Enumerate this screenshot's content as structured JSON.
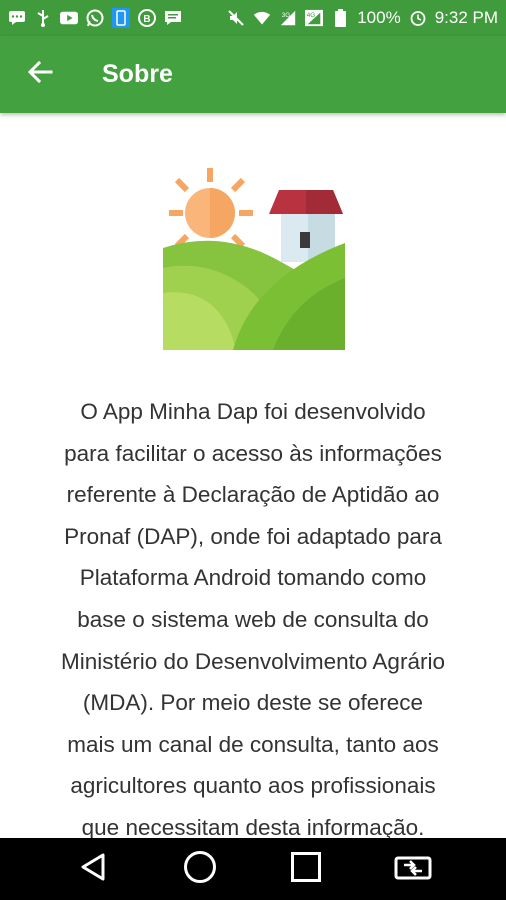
{
  "status_bar": {
    "battery": "100%",
    "time": "9:32 PM",
    "icons_left": [
      "chat-icon",
      "usb-icon",
      "youtube-icon",
      "whatsapp-icon",
      "phone-screen-icon",
      "bitcoin-icon",
      "message-icon"
    ],
    "icons_right": [
      "mute-icon",
      "wifi-icon",
      "signal-3g-icon",
      "signal-4g-icon",
      "battery-icon"
    ]
  },
  "app_bar": {
    "title": "Sobre",
    "back_icon": "arrow-back-icon"
  },
  "content": {
    "illustration": "farm-landscape-icon",
    "about_lines": [
      "O App Minha Dap foi desenvolvido",
      "para facilitar o acesso às informações",
      "referente à Declaração de Aptidão ao",
      "Pronaf (DAP), onde foi adaptado para",
      "Plataforma Android tomando como",
      "base o sistema web de consulta do",
      "Ministério do Desenvolvimento Agrário",
      "(MDA). Por meio deste se oferece",
      "mais um canal de consulta, tanto aos",
      "agricultores quanto aos profissionais",
      "que necessitam desta informação."
    ]
  },
  "nav_bar": {
    "buttons": [
      "back-triangle-icon",
      "home-circle-icon",
      "recents-square-icon",
      "switch-apps-icon"
    ]
  },
  "colors": {
    "status_bar": "#3f9b3b",
    "app_bar": "#43a140",
    "text": "#333333"
  }
}
